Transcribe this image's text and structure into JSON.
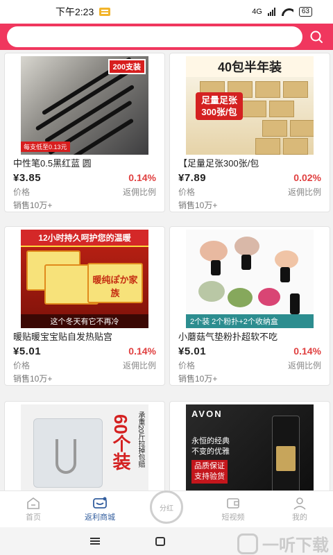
{
  "status_bar": {
    "time": "下午2:23",
    "network": "4G",
    "battery": "63"
  },
  "search": {
    "placeholder": "",
    "icon": "search-icon"
  },
  "products": [
    {
      "title": "中性笔0.5黑红蓝 圆",
      "price": "¥3.85",
      "ratio": "0.14%",
      "price_label": "价格",
      "ratio_label": "返佣比例",
      "sales": "销售10万+",
      "image_texts": [
        "200支装",
        "每支低至0.13元"
      ]
    },
    {
      "title": "【足量足张300张/包",
      "price": "¥7.89",
      "ratio": "0.02%",
      "price_label": "价格",
      "ratio_label": "返佣比例",
      "sales": "销售10万+",
      "image_texts": [
        "40包半年装",
        "足量足张",
        "300张/包"
      ]
    },
    {
      "title": "暖贴暖宝宝贴自发热贴宫",
      "price": "¥5.01",
      "ratio": "0.14%",
      "price_label": "价格",
      "ratio_label": "返佣比例",
      "sales": "销售10万+",
      "image_texts": [
        "12小时持久呵护您的温暖",
        "暖纯ぽか家族",
        "这个冬天有它不再冷"
      ]
    },
    {
      "title": "小蘑菇气垫粉扑超软不吃",
      "price": "¥5.01",
      "ratio": "0.14%",
      "price_label": "价格",
      "ratio_label": "返佣比例",
      "sales": "销售10万+",
      "image_texts": [
        "2个装 2个粉扑+2个收纳盒"
      ]
    },
    {
      "title": "",
      "image_texts": [
        "60个装",
        "承重20斤拉掉包赔"
      ]
    },
    {
      "title": "",
      "image_texts": [
        "AVON",
        "永恒的经典",
        "不变的优雅",
        "品质保证",
        "支持验货"
      ]
    }
  ],
  "bottom_nav": [
    {
      "label": "首页",
      "icon": "home-icon",
      "active": false
    },
    {
      "label": "返利商城",
      "icon": "mall-icon",
      "active": true
    },
    {
      "label": "分红",
      "icon": "dividend-icon",
      "active": false
    },
    {
      "label": "短视频",
      "icon": "video-icon",
      "active": false
    },
    {
      "label": "我的",
      "icon": "profile-icon",
      "active": false
    }
  ],
  "watermark": "一听下载",
  "colors": {
    "header": "#f0375e",
    "ratio": "#e04040",
    "nav_active": "#335e9e"
  }
}
